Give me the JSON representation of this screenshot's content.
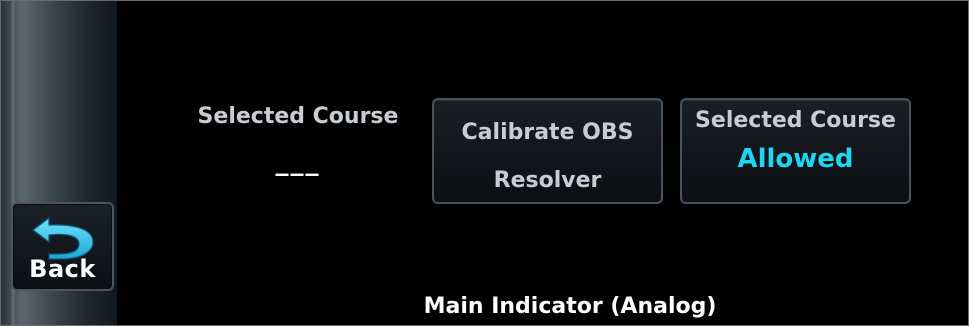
{
  "back_button": {
    "label": "Back"
  },
  "status": {
    "title": "Selected Course",
    "value": "___"
  },
  "buttons": {
    "calibrate": {
      "label_line1": "Calibrate OBS",
      "label_line2": "Resolver"
    },
    "selected_course": {
      "title": "Selected Course",
      "value": "Allowed"
    }
  },
  "footer": {
    "title": "Main Indicator (Analog)"
  },
  "colors": {
    "accent": "#1ed6f2",
    "background": "#000000",
    "text_primary": "#ffffff",
    "text_secondary": "#c9ccd0"
  },
  "icons": {
    "back": "back-arrow-icon"
  }
}
